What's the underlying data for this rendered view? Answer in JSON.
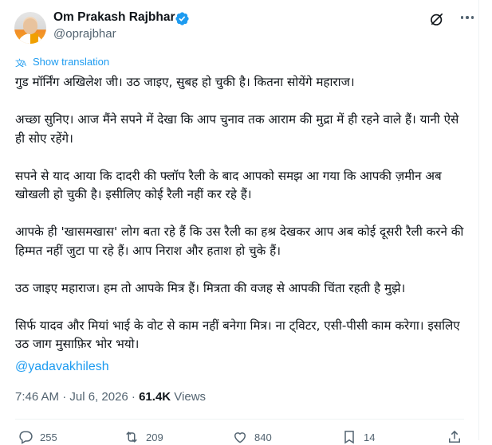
{
  "author": {
    "name": "Om Prakash Rajbhar",
    "handle": "@oprajbhar"
  },
  "translate_label": "Show translation",
  "paragraphs": [
    "गुड मॉर्निंग अखिलेश जी। उठ जाइए, सुबह हो चुकी है। कितना सोयेंगे महाराज।",
    "अच्छा सुनिए। आज मैंने सपने में देखा कि आप चुनाव तक आराम की मुद्रा में ही रहने वाले हैं। यानी ऐसे ही सोए रहेंगे।",
    "सपने से याद आया कि दादरी की फ्लॉप रैली के बाद आपको समझ आ गया कि आपकी ज़मीन अब खोखली हो चुकी है। इसीलिए कोई रैली नहीं कर रहे हैं।",
    "आपके ही 'खासमखास' लोग बता रहे हैं कि उस रैली का हश्र देखकर आप अब कोई दूसरी रैली करने की हिम्मत नहीं जुटा पा रहे हैं। आप निराश और हताश हो चुके हैं।",
    "उठ जाइए महाराज। हम तो आपके मित्र हैं। मित्रता की वजह से आपकी चिंता रहती है मुझे।",
    "सिर्फ यादव और मियां भाई के वोट से काम नहीं बनेगा मित्र। ना ट्विटर, एसी-पीसी काम करेगा। इसलिए उठ जाग मुसाफ़िर भोर भयो।"
  ],
  "mention": "@yadavakhilesh",
  "timestamp": "7:46 AM · Jul 6, 2026 · ",
  "views_count": "61.4K",
  "views_label": " Views",
  "actions": {
    "replies": "255",
    "reposts": "209",
    "likes": "840",
    "bookmarks": "14"
  },
  "colors": {
    "accent": "#1d9bf0",
    "secondary_text": "#536471",
    "primary_text": "#0f1419"
  }
}
